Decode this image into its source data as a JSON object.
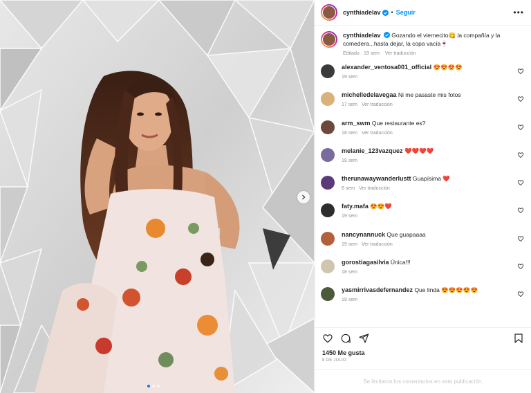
{
  "post": {
    "username": "cynthiadelav",
    "follow_label": "Seguir",
    "dot_separator": "•",
    "more_label": "•••",
    "caption_text": "Gozando el viernecito😋 la compañía y la comedera...hasta dejar, la copa vacía🍷",
    "caption_edited": "Editado · 19 sem",
    "caption_translate": "Ver traducción"
  },
  "comments": [
    {
      "user": "alexander_ventosa001_official",
      "text": "😍😍😍😍",
      "time": "19 sem",
      "translate": "",
      "avatar_color": "#3b3b3b"
    },
    {
      "user": "michelledelavegaa",
      "text": "Ni me pasaste mis fotos",
      "time": "17 sem",
      "translate": "Ver traducción",
      "avatar_color": "#d8b27a"
    },
    {
      "user": "arm_swm",
      "text": "Que restaurante es?",
      "time": "18 sem",
      "translate": "Ver traducción",
      "avatar_color": "#6b4a3a"
    },
    {
      "user": "melanie_123vazquez",
      "text": "❤️❤️❤️❤️",
      "time": "19 sem",
      "translate": "",
      "avatar_color": "#7a6b9e"
    },
    {
      "user": "therunawaywanderlustt",
      "text": "Guapísima ❤️",
      "time": "6 sem",
      "translate": "Ver traducción",
      "avatar_color": "#5c3a7a"
    },
    {
      "user": "faty.mafa",
      "text": "😍😍❤️",
      "time": "19 sem",
      "translate": "",
      "avatar_color": "#2d2d2d"
    },
    {
      "user": "nancynannuck",
      "text": "Que guapaaaa",
      "time": "19 sem",
      "translate": "Ver traducción",
      "avatar_color": "#b5603d"
    },
    {
      "user": "gorostiagasilvia",
      "text": "Única!!!",
      "time": "18 sem",
      "translate": "",
      "avatar_color": "#cfc6b0"
    },
    {
      "user": "yasmirrivasdefernandez",
      "text": "Que linda 😍😍😍😍😍",
      "time": "19 sem",
      "translate": "",
      "avatar_color": "#4a5a3a"
    }
  ],
  "actions": {
    "like_icon": "heart-icon",
    "comment_icon": "comment-icon",
    "share_icon": "share-icon",
    "save_icon": "bookmark-icon"
  },
  "likes_text": "1450 Me gusta",
  "date_text": "8 DE JULIO",
  "comments_limited_text": "Se limitaron los comentarios en esta publicación.",
  "colors": {
    "link_blue": "#0095f6",
    "muted": "#8e8e8e",
    "heart_red": "#ed4956"
  }
}
